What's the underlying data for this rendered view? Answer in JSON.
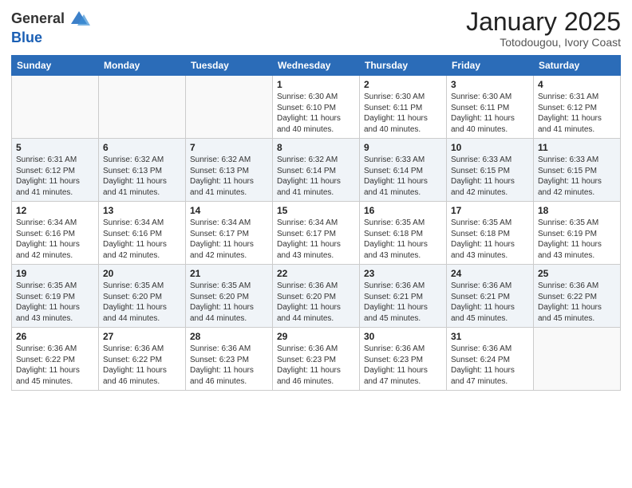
{
  "logo": {
    "general": "General",
    "blue": "Blue"
  },
  "title": {
    "month": "January 2025",
    "location": "Totodougou, Ivory Coast"
  },
  "headers": [
    "Sunday",
    "Monday",
    "Tuesday",
    "Wednesday",
    "Thursday",
    "Friday",
    "Saturday"
  ],
  "weeks": [
    [
      {
        "day": "",
        "info": ""
      },
      {
        "day": "",
        "info": ""
      },
      {
        "day": "",
        "info": ""
      },
      {
        "day": "1",
        "info": "Sunrise: 6:30 AM\nSunset: 6:10 PM\nDaylight: 11 hours and 40 minutes."
      },
      {
        "day": "2",
        "info": "Sunrise: 6:30 AM\nSunset: 6:11 PM\nDaylight: 11 hours and 40 minutes."
      },
      {
        "day": "3",
        "info": "Sunrise: 6:30 AM\nSunset: 6:11 PM\nDaylight: 11 hours and 40 minutes."
      },
      {
        "day": "4",
        "info": "Sunrise: 6:31 AM\nSunset: 6:12 PM\nDaylight: 11 hours and 41 minutes."
      }
    ],
    [
      {
        "day": "5",
        "info": "Sunrise: 6:31 AM\nSunset: 6:12 PM\nDaylight: 11 hours and 41 minutes."
      },
      {
        "day": "6",
        "info": "Sunrise: 6:32 AM\nSunset: 6:13 PM\nDaylight: 11 hours and 41 minutes."
      },
      {
        "day": "7",
        "info": "Sunrise: 6:32 AM\nSunset: 6:13 PM\nDaylight: 11 hours and 41 minutes."
      },
      {
        "day": "8",
        "info": "Sunrise: 6:32 AM\nSunset: 6:14 PM\nDaylight: 11 hours and 41 minutes."
      },
      {
        "day": "9",
        "info": "Sunrise: 6:33 AM\nSunset: 6:14 PM\nDaylight: 11 hours and 41 minutes."
      },
      {
        "day": "10",
        "info": "Sunrise: 6:33 AM\nSunset: 6:15 PM\nDaylight: 11 hours and 42 minutes."
      },
      {
        "day": "11",
        "info": "Sunrise: 6:33 AM\nSunset: 6:15 PM\nDaylight: 11 hours and 42 minutes."
      }
    ],
    [
      {
        "day": "12",
        "info": "Sunrise: 6:34 AM\nSunset: 6:16 PM\nDaylight: 11 hours and 42 minutes."
      },
      {
        "day": "13",
        "info": "Sunrise: 6:34 AM\nSunset: 6:16 PM\nDaylight: 11 hours and 42 minutes."
      },
      {
        "day": "14",
        "info": "Sunrise: 6:34 AM\nSunset: 6:17 PM\nDaylight: 11 hours and 42 minutes."
      },
      {
        "day": "15",
        "info": "Sunrise: 6:34 AM\nSunset: 6:17 PM\nDaylight: 11 hours and 43 minutes."
      },
      {
        "day": "16",
        "info": "Sunrise: 6:35 AM\nSunset: 6:18 PM\nDaylight: 11 hours and 43 minutes."
      },
      {
        "day": "17",
        "info": "Sunrise: 6:35 AM\nSunset: 6:18 PM\nDaylight: 11 hours and 43 minutes."
      },
      {
        "day": "18",
        "info": "Sunrise: 6:35 AM\nSunset: 6:19 PM\nDaylight: 11 hours and 43 minutes."
      }
    ],
    [
      {
        "day": "19",
        "info": "Sunrise: 6:35 AM\nSunset: 6:19 PM\nDaylight: 11 hours and 43 minutes."
      },
      {
        "day": "20",
        "info": "Sunrise: 6:35 AM\nSunset: 6:20 PM\nDaylight: 11 hours and 44 minutes."
      },
      {
        "day": "21",
        "info": "Sunrise: 6:35 AM\nSunset: 6:20 PM\nDaylight: 11 hours and 44 minutes."
      },
      {
        "day": "22",
        "info": "Sunrise: 6:36 AM\nSunset: 6:20 PM\nDaylight: 11 hours and 44 minutes."
      },
      {
        "day": "23",
        "info": "Sunrise: 6:36 AM\nSunset: 6:21 PM\nDaylight: 11 hours and 45 minutes."
      },
      {
        "day": "24",
        "info": "Sunrise: 6:36 AM\nSunset: 6:21 PM\nDaylight: 11 hours and 45 minutes."
      },
      {
        "day": "25",
        "info": "Sunrise: 6:36 AM\nSunset: 6:22 PM\nDaylight: 11 hours and 45 minutes."
      }
    ],
    [
      {
        "day": "26",
        "info": "Sunrise: 6:36 AM\nSunset: 6:22 PM\nDaylight: 11 hours and 45 minutes."
      },
      {
        "day": "27",
        "info": "Sunrise: 6:36 AM\nSunset: 6:22 PM\nDaylight: 11 hours and 46 minutes."
      },
      {
        "day": "28",
        "info": "Sunrise: 6:36 AM\nSunset: 6:23 PM\nDaylight: 11 hours and 46 minutes."
      },
      {
        "day": "29",
        "info": "Sunrise: 6:36 AM\nSunset: 6:23 PM\nDaylight: 11 hours and 46 minutes."
      },
      {
        "day": "30",
        "info": "Sunrise: 6:36 AM\nSunset: 6:23 PM\nDaylight: 11 hours and 47 minutes."
      },
      {
        "day": "31",
        "info": "Sunrise: 6:36 AM\nSunset: 6:24 PM\nDaylight: 11 hours and 47 minutes."
      },
      {
        "day": "",
        "info": ""
      }
    ]
  ]
}
